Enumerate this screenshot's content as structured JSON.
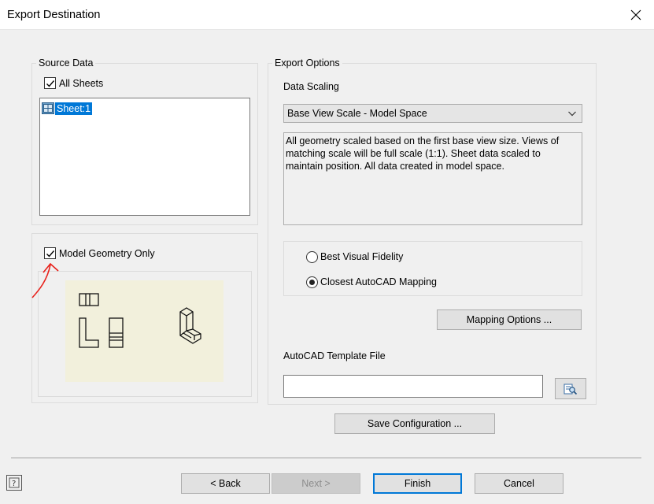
{
  "window": {
    "title": "Export Destination"
  },
  "source_data": {
    "group_label": "Source Data",
    "all_sheets_label": "All Sheets",
    "all_sheets_checked": true,
    "sheets": [
      {
        "label": "Sheet:1",
        "selected": true
      }
    ]
  },
  "model_geometry": {
    "label": "Model Geometry Only",
    "checked": true
  },
  "export_options": {
    "group_label": "Export Options",
    "data_scaling_label": "Data Scaling",
    "data_scaling_value": "Base View Scale - Model Space",
    "description": "All geometry scaled based on the first base view size. Views of matching scale will be full scale (1:1). Sheet data scaled to maintain position. All data created in model space.",
    "radio_best_visual": "Best Visual Fidelity",
    "radio_closest_autocad": "Closest AutoCAD Mapping",
    "selected_radio": "Closest AutoCAD Mapping",
    "mapping_options_label": "Mapping Options ...",
    "template_label": "AutoCAD Template File",
    "template_value": ""
  },
  "buttons": {
    "save_config": "Save Configuration ...",
    "back": "< Back",
    "next": "Next >",
    "finish": "Finish",
    "cancel": "Cancel"
  },
  "colors": {
    "accent": "#0078d7",
    "annotation": "#e8201a",
    "preview_bg": "#f2f0dc"
  }
}
